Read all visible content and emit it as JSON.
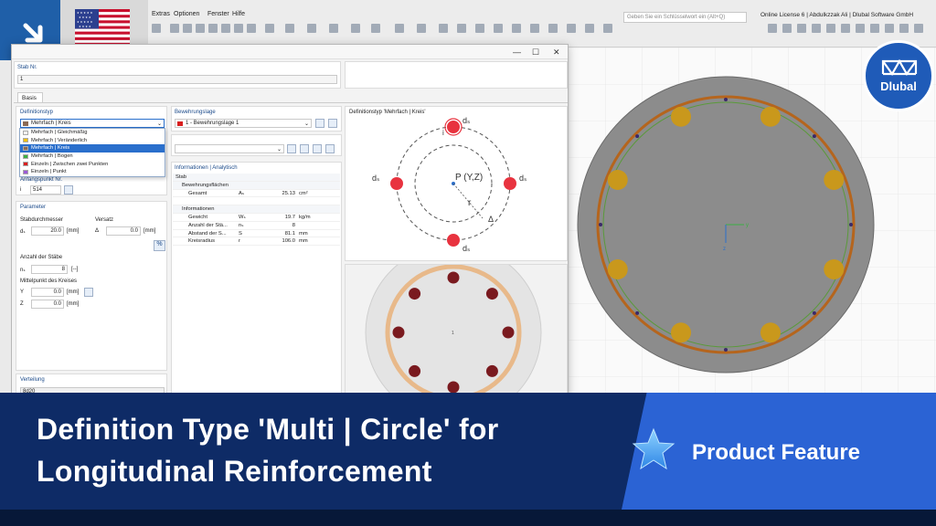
{
  "menu": [
    "Extras",
    "Optionen",
    "Fenster",
    "Hilfe"
  ],
  "search_placeholder": "Geben Sie ein Schlüsselwort ein (Alt+Q)",
  "license": "Online License 6 | Abdulkzzak Ali | Dlubal Software GmbH",
  "dialog": {
    "stab_label": "Stab Nr.",
    "stab_value": "1",
    "tab": "Basis",
    "defin_label": "Definitionstyp",
    "defin_value": "Mehrfach | Kreis",
    "dropdown": [
      {
        "label": "Mehrfach | Gleichmäßig",
        "color": "#f2f2f2",
        "selected": false
      },
      {
        "label": "Mehrfach | Veränderlich",
        "color": "#f0c000",
        "selected": false
      },
      {
        "label": "Mehrfach | Kreis",
        "color": "#8a6a55",
        "selected": true
      },
      {
        "label": "Mehrfach | Bogen",
        "color": "#3cb043",
        "selected": false
      },
      {
        "label": "Einzeln | Zwischen zwei Punkten",
        "color": "#d81e1e",
        "selected": false
      },
      {
        "label": "Einzeln | Punkt",
        "color": "#9b59d6",
        "selected": false
      }
    ],
    "anfang_label": "Anfangspunkt Nr.",
    "anfang_sym": "i",
    "anfang_value": "514",
    "param_label": "Parameter",
    "stab_d_label": "Stabdurchmesser",
    "stab_d_sym": "dₛ",
    "stab_d_value": "20.0",
    "stab_d_unit": "[mm]",
    "versatz_label": "Versatz",
    "versatz_sym": "Δ",
    "versatz_value": "0.0",
    "versatz_unit": "[mm]",
    "anzahl_label": "Anzahl der Stäbe",
    "anzahl_sym": "nₛ",
    "anzahl_value": "8",
    "anzahl_unit": "[--]",
    "mittel_label": "Mittelpunkt des Kreises",
    "y_sym": "Y",
    "y_value": "0.0",
    "y_unit": "[mm]",
    "z_sym": "Z",
    "z_value": "0.0",
    "z_unit": "[mm]",
    "vert_label": "Verteilung",
    "vert_value": "8d20",
    "bew_label": "Bewehrungslage",
    "bew_value": "1 - Bewehrungslage 1",
    "info_label": "Informationen | Analytisch",
    "info_rows": [
      {
        "name": "Stab",
        "sym": "",
        "val": "",
        "unit": "",
        "indent": 0,
        "group": true
      },
      {
        "name": "Bewehrungsflächen",
        "sym": "",
        "val": "",
        "unit": "",
        "indent": 1,
        "group": true
      },
      {
        "name": "Gesamt",
        "sym": "Aₛ",
        "val": "25.13",
        "unit": "cm²",
        "indent": 2,
        "group": false
      },
      {
        "name": "",
        "sym": "",
        "val": "",
        "unit": "",
        "indent": 0,
        "group": false
      },
      {
        "name": "Informationen",
        "sym": "",
        "val": "",
        "unit": "",
        "indent": 1,
        "group": true
      },
      {
        "name": "Gewicht",
        "sym": "Wₛ",
        "val": "19.7",
        "unit": "kg/m",
        "indent": 2,
        "group": false
      },
      {
        "name": "Anzahl der Stä...",
        "sym": "nₛ",
        "val": "8",
        "unit": "",
        "indent": 2,
        "group": false
      },
      {
        "name": "Abstand der S...",
        "sym": "S",
        "val": "81.1",
        "unit": "mm",
        "indent": 2,
        "group": false
      },
      {
        "name": "Kreisradius",
        "sym": "r",
        "val": "106.0",
        "unit": "mm",
        "indent": 2,
        "group": false
      }
    ],
    "diag_title": "Definitionstyp 'Mehrfach | Kreis'",
    "diag_ds": "dₛ",
    "diag_i": "i",
    "diag_p": "P (Y,Z)",
    "diag_r": "r",
    "diag_delta": "Δ",
    "section_num": "1"
  },
  "viewport": {
    "y_axis": "y",
    "z_axis": "z"
  },
  "logo_text": "Dlubal",
  "banner": {
    "title_line1": "Definition Type 'Multi | Circle' for",
    "title_line2": "Longitudinal Reinforcement",
    "feature": "Product Feature"
  },
  "colors": {
    "accent": "#2b63d4",
    "banner": "#0e2b66",
    "rebar_red": "#e8333f",
    "rebar_dark": "#7a1a1f",
    "rebar_gold": "#c9981c",
    "concrete": "#8c8c8c"
  }
}
